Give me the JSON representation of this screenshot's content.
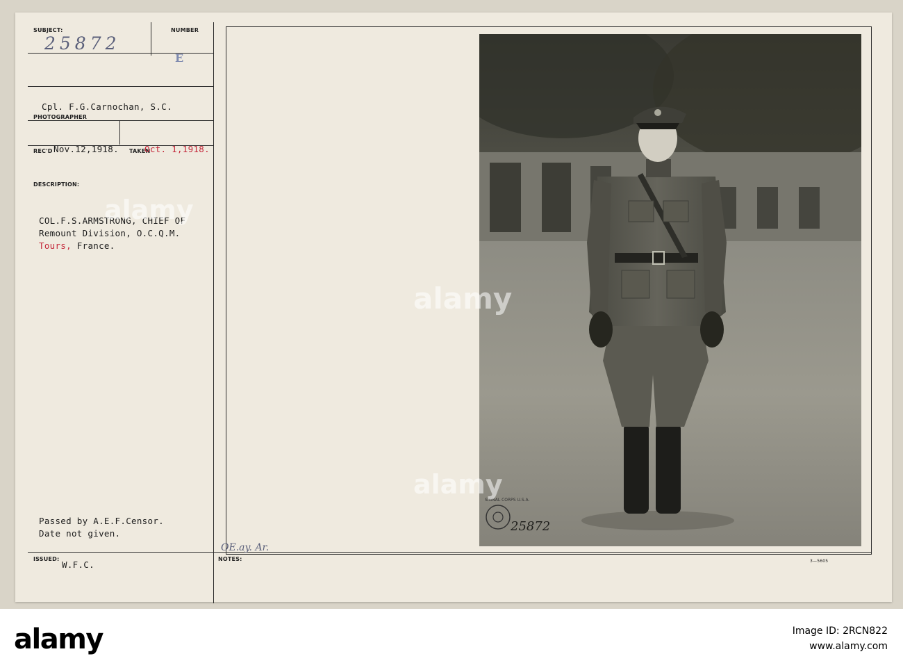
{
  "card": {
    "subject_label": "SUBJECT:",
    "subject_value": "25872",
    "number_label": "NUMBER",
    "number_value": "E",
    "photographer_value": "Cpl. F.G.Carnochan, S.C.",
    "photographer_label": "PHOTOGRAPHER",
    "recd_label": "REC'D",
    "recd_value": "Nov.12,1918.",
    "taken_label": "TAKEN",
    "taken_value": "Oct. 1,1918.",
    "description_label": "DESCRIPTION:",
    "desc_line1": "COL.F.S.ARMSTRONG, CHIEF OF",
    "desc_line2": "Remount Division, O.C.Q.M.",
    "desc_line3_city": "Tours,",
    "desc_line3_country": "France.",
    "censor_line1": "Passed by A.E.F.Censor.",
    "censor_line2": "Date not given.",
    "issued_label": "ISSUED:",
    "issued_value": "W.F.C.",
    "notes_label": "NOTES:",
    "notes_handwriting": "OE.ay. Ar.",
    "form_code": "3—5605"
  },
  "photo": {
    "stamp_text": "SIGNAL CORPS U.S.A.",
    "photo_number": "25872"
  },
  "watermark": "alamy",
  "footer": {
    "logo": "alamy",
    "image_id_label": "Image ID:",
    "image_id": "2RCN822",
    "site": "www.alamy.com"
  }
}
